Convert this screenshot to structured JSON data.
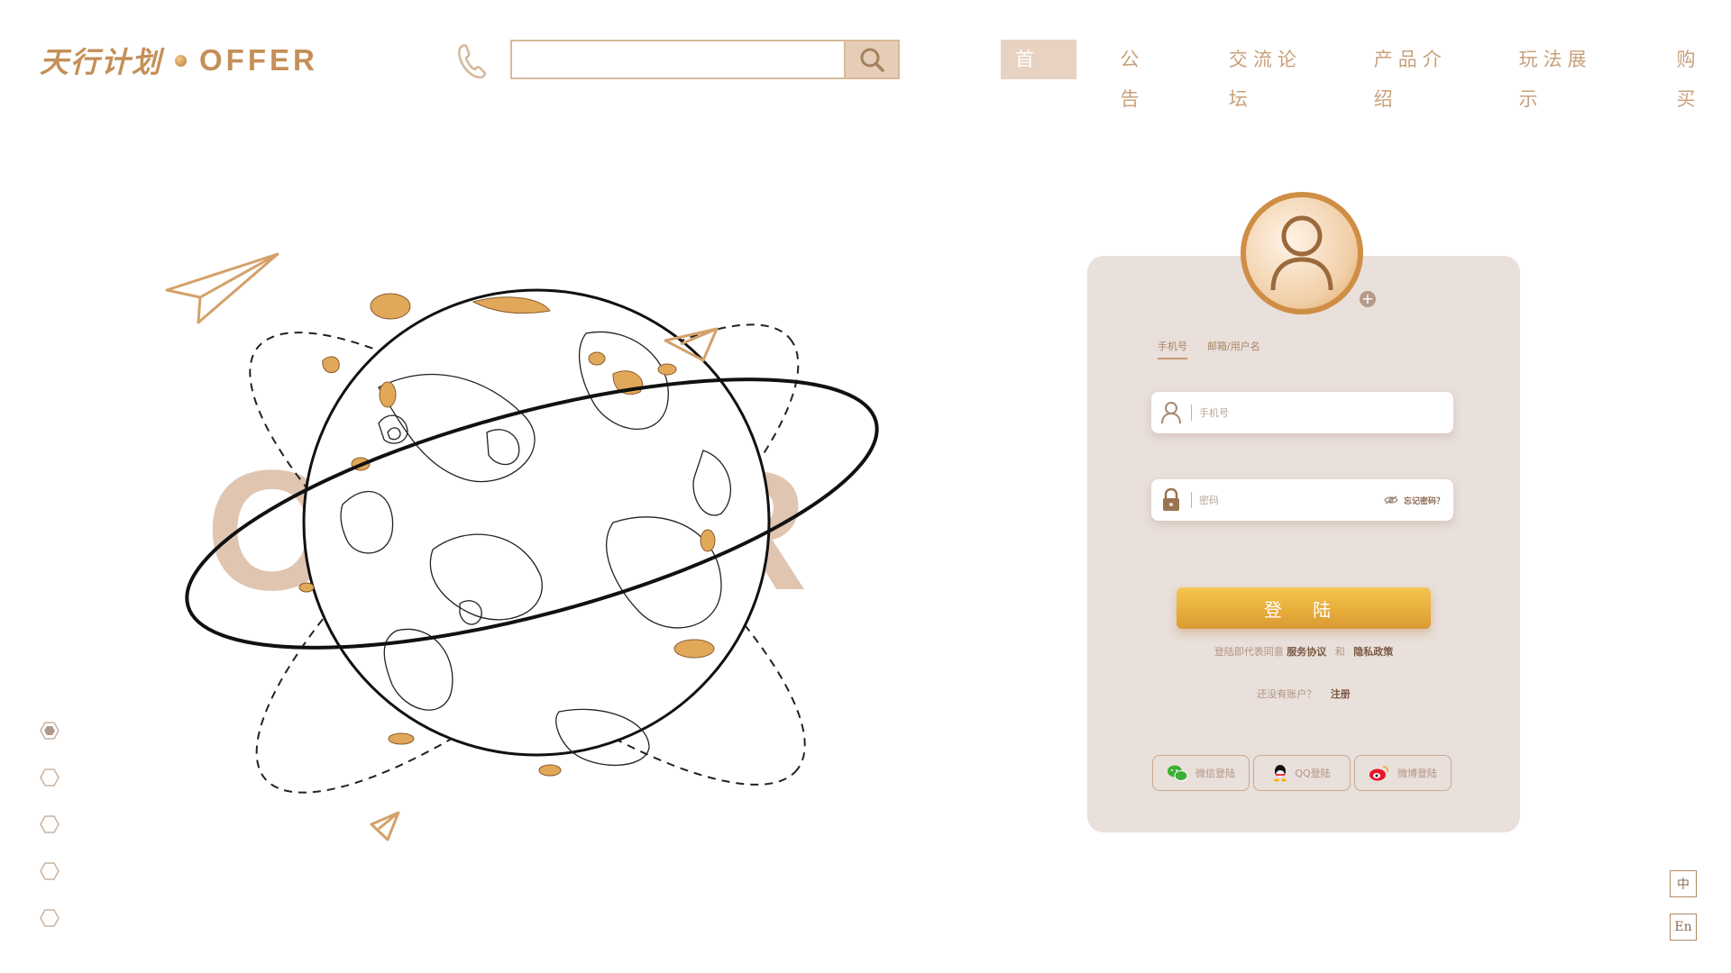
{
  "header": {
    "logo_cn": "天行计划",
    "logo_en": "OFFER",
    "search": {
      "value": "",
      "placeholder": ""
    },
    "nav": [
      {
        "label": "首页",
        "active": true
      },
      {
        "label": "公告",
        "active": false
      },
      {
        "label": "交流论坛",
        "active": false
      },
      {
        "label": "产品介绍",
        "active": false
      },
      {
        "label": "玩法展示",
        "active": false
      },
      {
        "label": "购买",
        "active": false
      }
    ]
  },
  "hero": {
    "big_word": "OFFER"
  },
  "login": {
    "tabs": [
      "手机号",
      "邮箱/用户名"
    ],
    "phone_placeholder": "手机号",
    "password_placeholder": "密码",
    "forgot": "忘记密码？",
    "login_button": "登 陆",
    "agree_prefix": "登陆即代表同意",
    "service_agreement": "服务协议",
    "and": "和",
    "privacy_policy": "隐私政策",
    "no_account": "还没有账户？",
    "register": "注册",
    "social": [
      "微信登陆",
      "QQ登陆",
      "微博登陆"
    ]
  },
  "lang": [
    "中",
    "En"
  ],
  "colors": {
    "accent": "#c48f58",
    "card": "#e9dfdb",
    "button": "#e8ad3b"
  },
  "icons": [
    "phone-icon",
    "search-icon",
    "user-icon",
    "lock-icon",
    "eye-off-icon",
    "wechat-icon",
    "qq-icon",
    "weibo-icon",
    "hexagon-icon",
    "paper-plane-icon"
  ]
}
